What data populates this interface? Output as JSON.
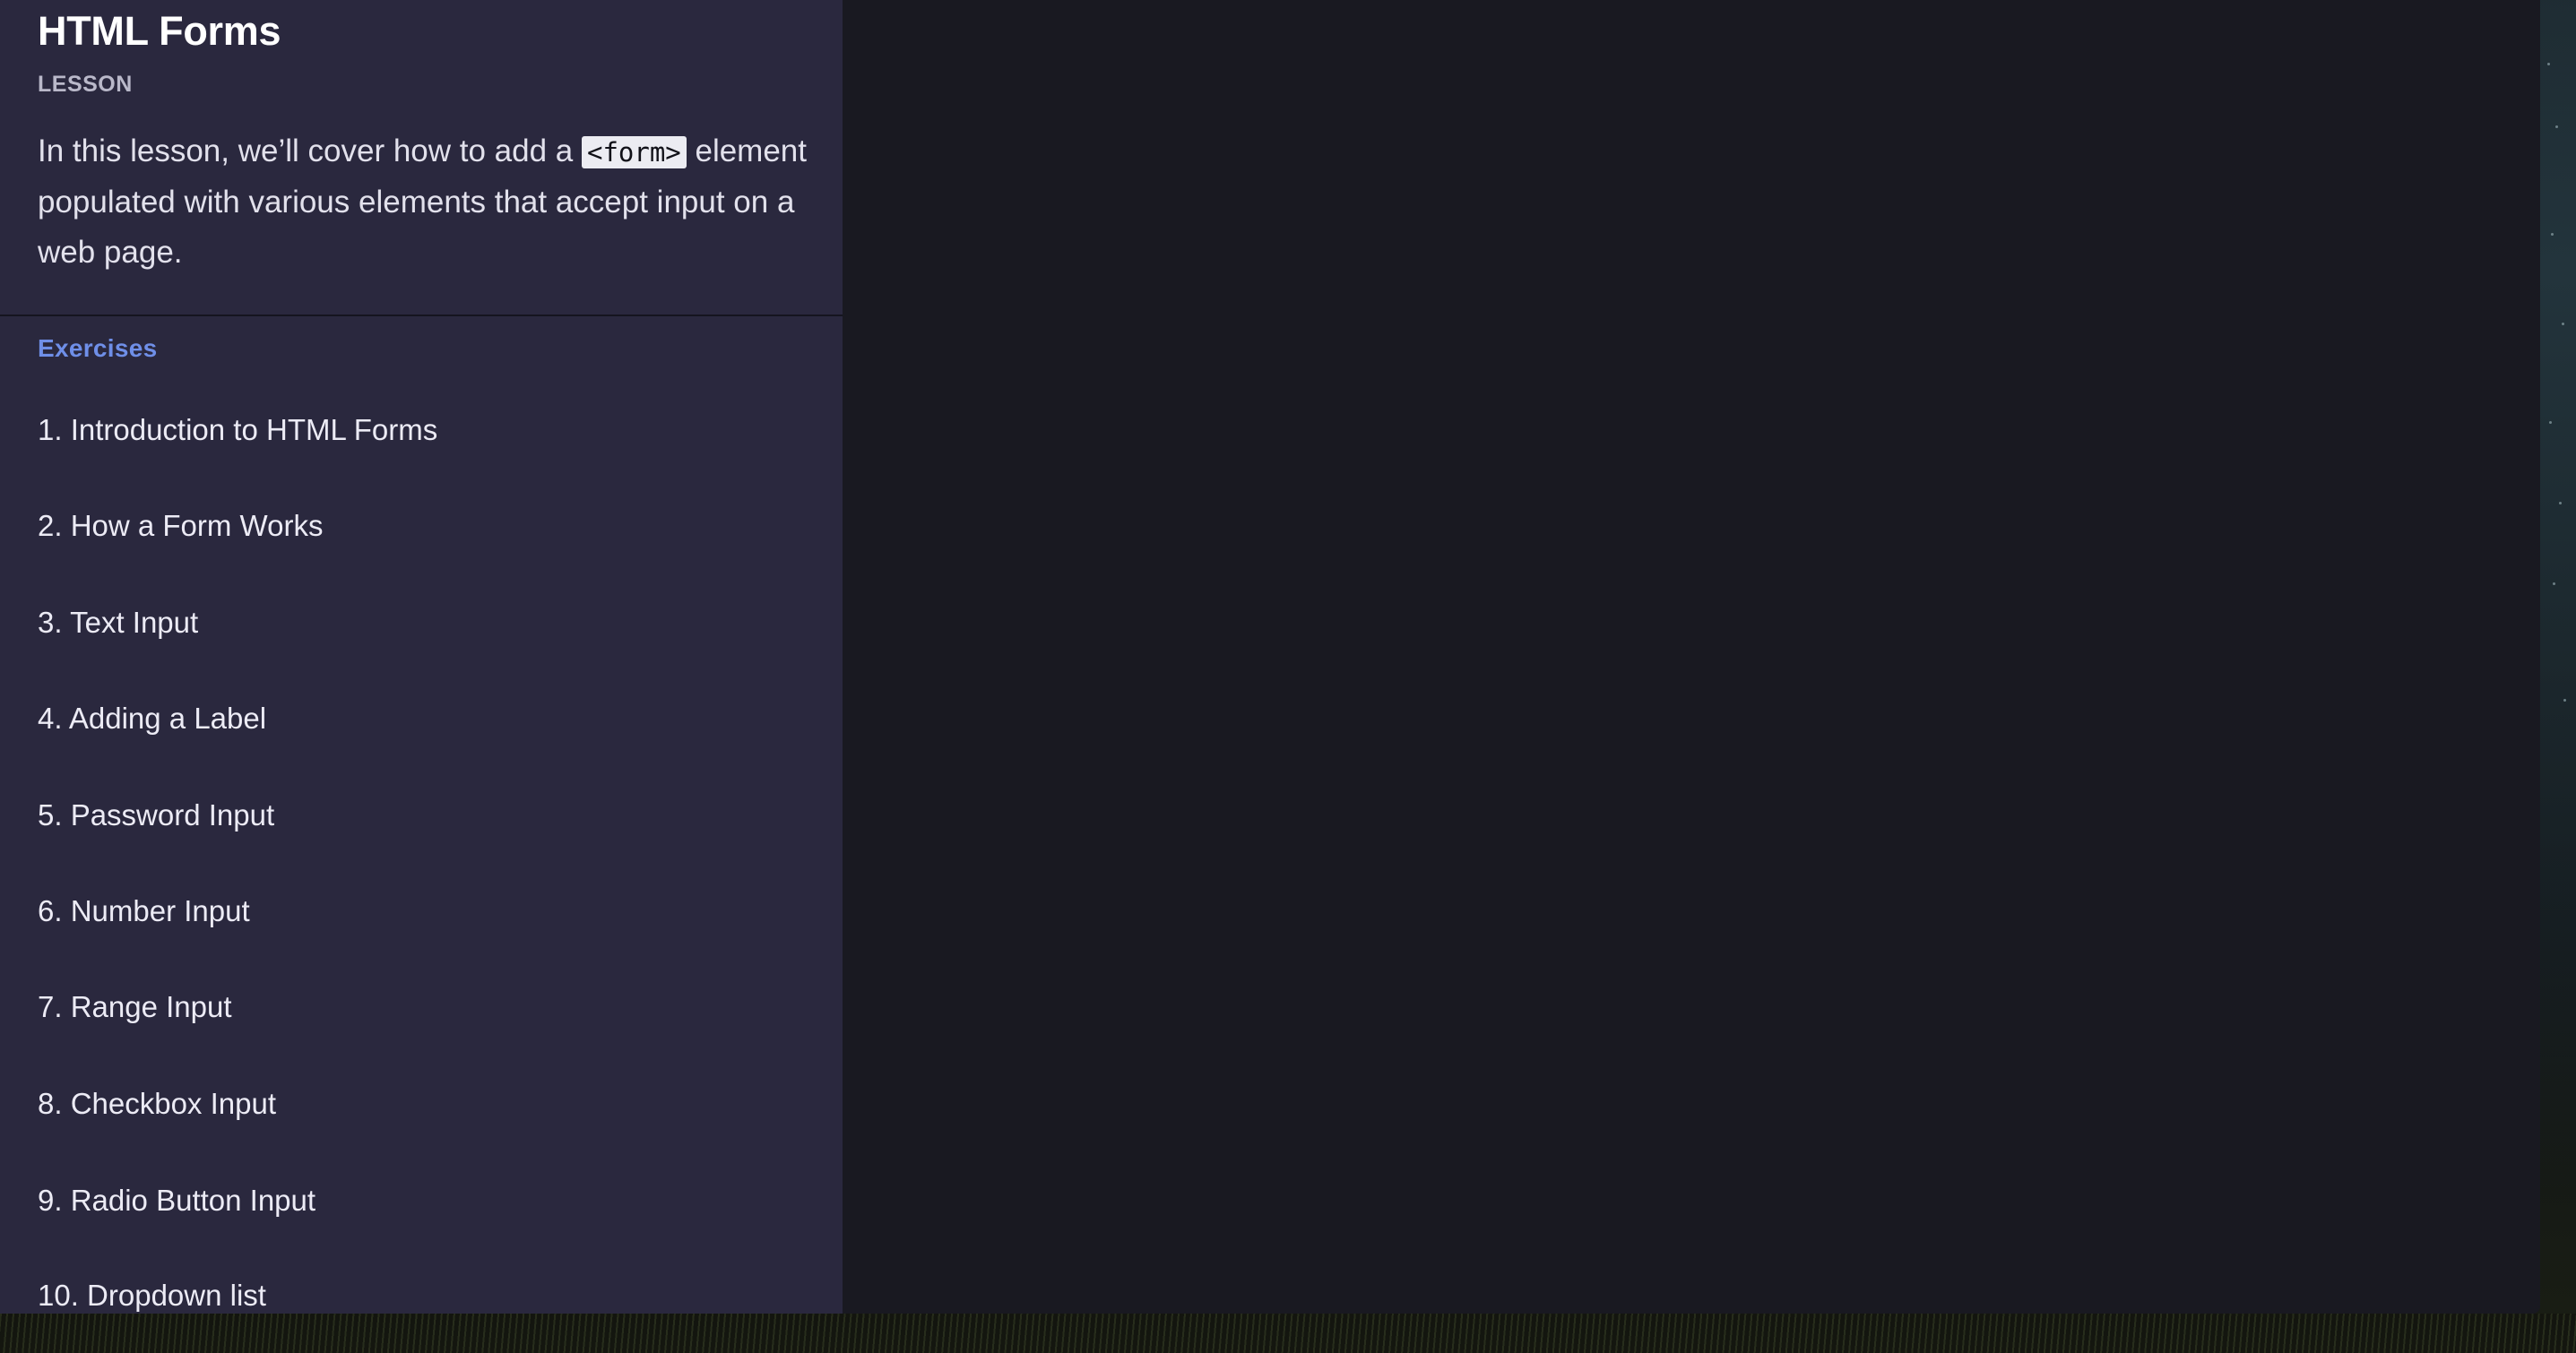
{
  "lesson": {
    "title": "HTML Forms",
    "kind": "LESSON",
    "description_before": "In this lesson, we’ll cover how to add a ",
    "description_code": "<form>",
    "description_after": " element populated with various elements that accept input on a web page."
  },
  "exercises": {
    "heading": "Exercises",
    "items": [
      {
        "label": "1. Introduction to HTML Forms"
      },
      {
        "label": "2. How a Form Works"
      },
      {
        "label": "3. Text Input"
      },
      {
        "label": "4. Adding a Label"
      },
      {
        "label": "5. Password Input"
      },
      {
        "label": "6. Number Input"
      },
      {
        "label": "7. Range Input"
      },
      {
        "label": "8. Checkbox Input"
      },
      {
        "label": "9. Radio Button Input"
      },
      {
        "label": "10. Dropdown list"
      }
    ]
  },
  "colors": {
    "sidebar_bg": "#2a283e",
    "main_bg": "#191921",
    "exercises_heading": "#6f8fe8"
  }
}
